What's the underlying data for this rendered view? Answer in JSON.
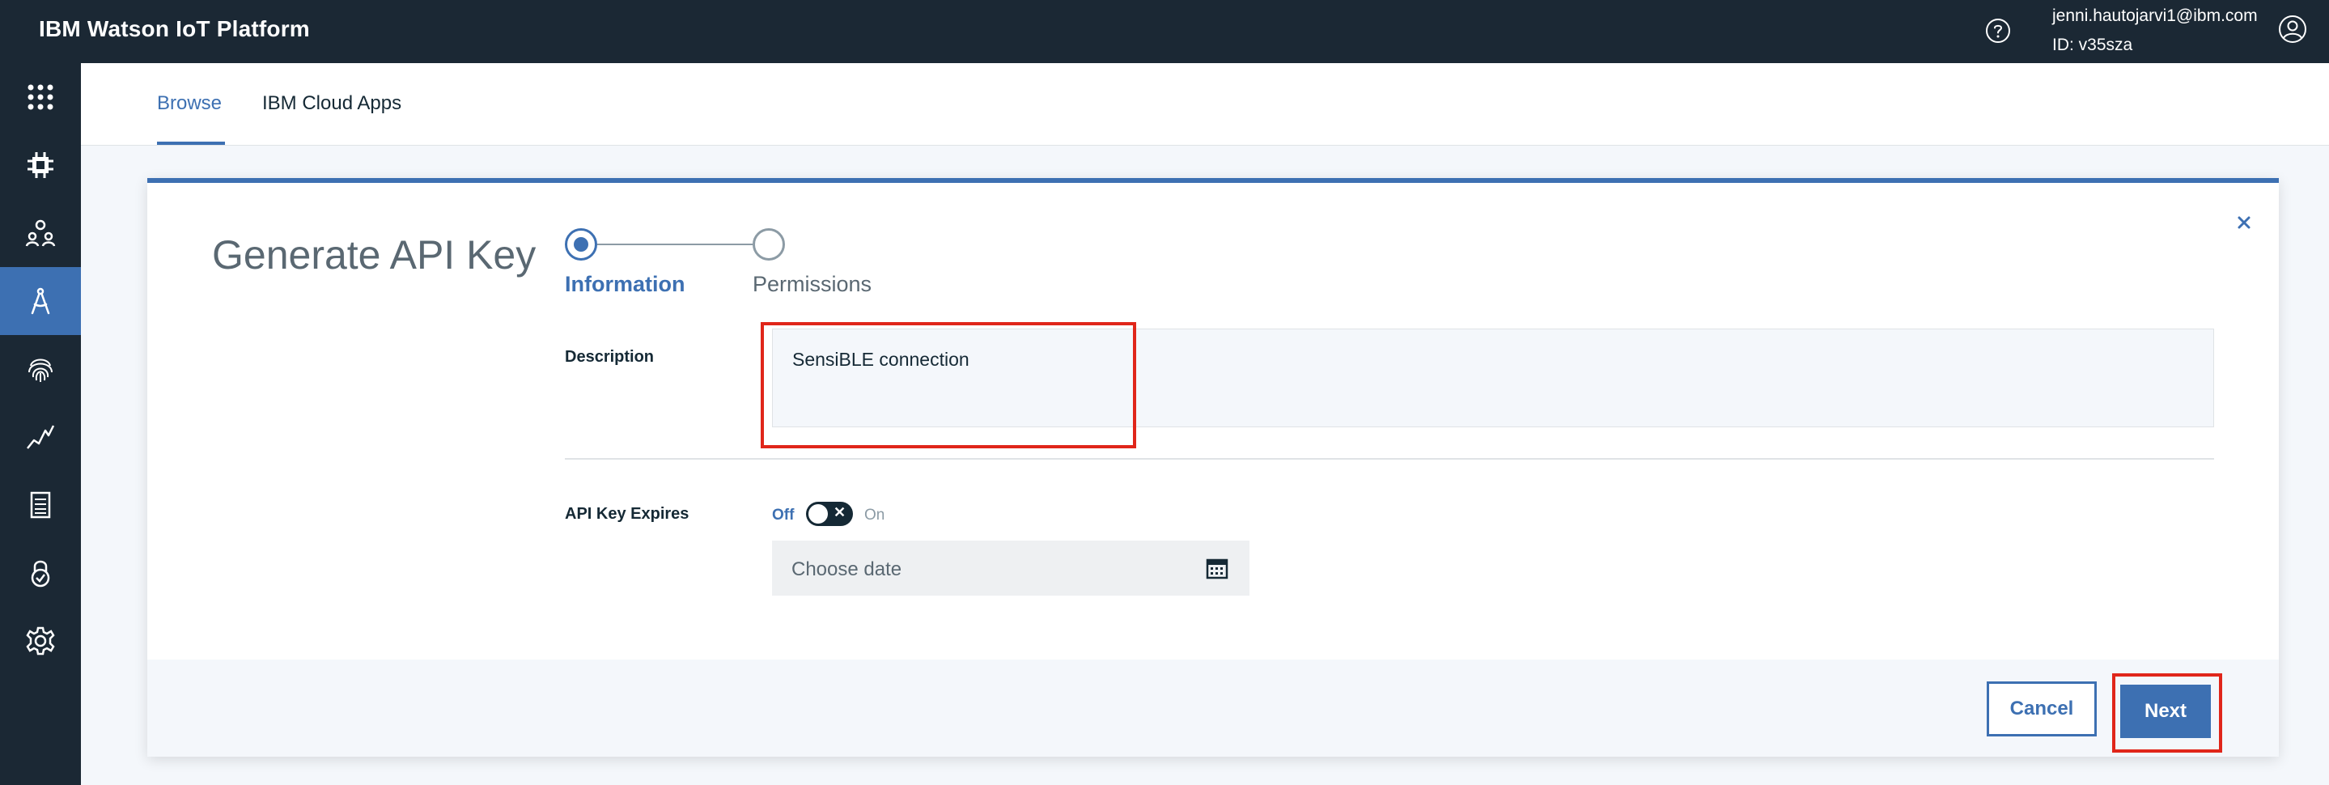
{
  "header": {
    "app_title": "IBM Watson IoT Platform",
    "user_email": "jenni.hautojarvi1@ibm.com",
    "user_id": "ID: v35sza",
    "icons": [
      "help-icon",
      "user-avatar-icon"
    ]
  },
  "sidebar": {
    "items": [
      {
        "name": "apps-grid",
        "icon": "grid-icon",
        "active": false
      },
      {
        "name": "devices",
        "icon": "chip-icon",
        "active": false
      },
      {
        "name": "members",
        "icon": "members-icon",
        "active": false
      },
      {
        "name": "apps",
        "icon": "compass-icon",
        "active": true
      },
      {
        "name": "security",
        "icon": "fingerprint-icon",
        "active": false
      },
      {
        "name": "usage",
        "icon": "chart-icon",
        "active": false
      },
      {
        "name": "rules",
        "icon": "document-icon",
        "active": false
      },
      {
        "name": "risk",
        "icon": "lock-check-icon",
        "active": false
      },
      {
        "name": "settings",
        "icon": "gear-icon",
        "active": false
      }
    ]
  },
  "tabs": [
    {
      "label": "Browse",
      "active": true
    },
    {
      "label": "IBM Cloud Apps",
      "active": false
    }
  ],
  "modal": {
    "title": "Generate API Key",
    "steps": [
      {
        "label": "Information",
        "active": true
      },
      {
        "label": "Permissions",
        "active": false
      }
    ],
    "description": {
      "label": "Description",
      "value": "SensiBLE connection"
    },
    "expires": {
      "label": "API Key Expires",
      "toggle_off": "Off",
      "toggle_on": "On",
      "toggle_state": "off",
      "date_placeholder": "Choose date"
    },
    "buttons": {
      "cancel": "Cancel",
      "next": "Next"
    }
  },
  "colors": {
    "topbar": "#1b2834",
    "accent": "#3d70b2",
    "highlight": "#e0261a"
  }
}
